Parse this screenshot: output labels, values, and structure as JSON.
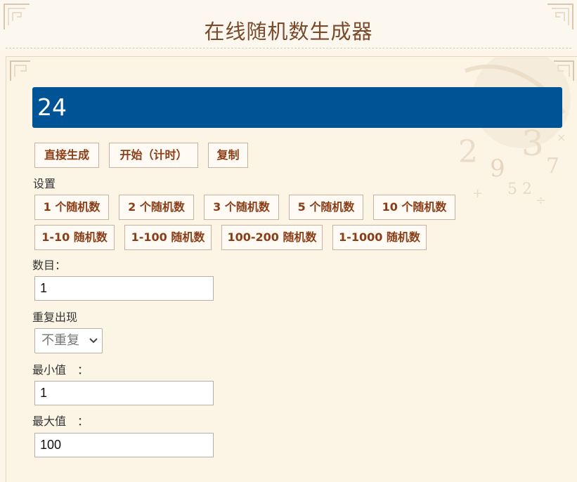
{
  "header": {
    "title": "在线随机数生成器"
  },
  "result": {
    "value": "24"
  },
  "actions": {
    "generate": "直接生成",
    "start": "开始（计时）",
    "copy": "复制"
  },
  "settings": {
    "label": "设置",
    "count_presets": [
      "1 个随机数",
      "2 个随机数",
      "3 个随机数",
      "5 个随机数",
      "10 个随机数"
    ],
    "range_presets": [
      "1-10 随机数",
      "1-100 随机数",
      "100-200 随机数",
      "1-1000 随机数"
    ]
  },
  "form": {
    "count_label": "数目：",
    "count_value": "1",
    "repeat_label": "重复出现",
    "repeat_selected": "不重复",
    "min_label": "最小值　：",
    "min_value": "1",
    "max_label": "最大值　：",
    "max_value": "100"
  },
  "colors": {
    "result_bg": "#005496",
    "button_text": "#8a3d16",
    "title_text": "#7a4a2c",
    "page_bg": "#fdf5e7"
  }
}
